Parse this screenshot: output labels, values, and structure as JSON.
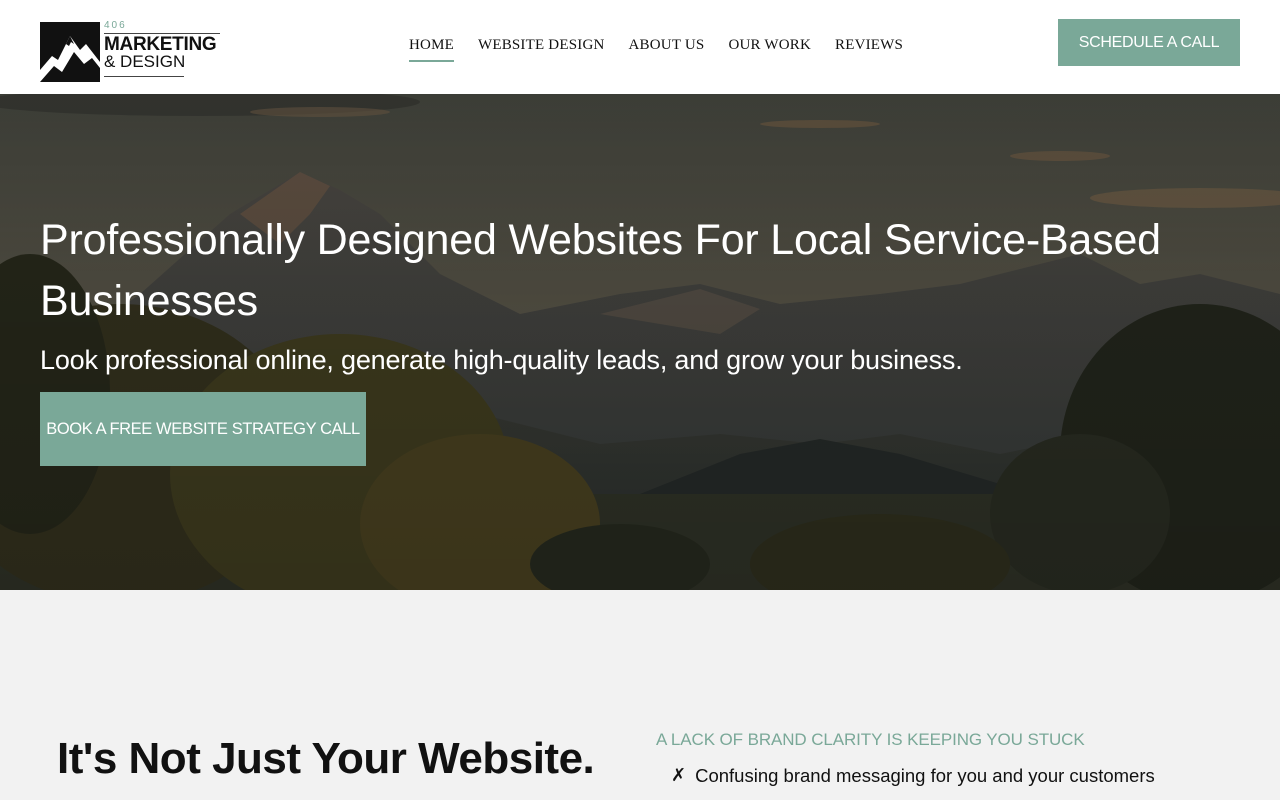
{
  "brand": {
    "number": "406",
    "line1": "MARKETING",
    "line2": "& DESIGN"
  },
  "nav": [
    {
      "label": "HOME",
      "active": true
    },
    {
      "label": "WEBSITE DESIGN",
      "active": false
    },
    {
      "label": "ABOUT US",
      "active": false
    },
    {
      "label": "OUR WORK",
      "active": false
    },
    {
      "label": "REVIEWS",
      "active": false
    }
  ],
  "header": {
    "cta_label": "SCHEDULE A CALL"
  },
  "hero": {
    "title": "Professionally Designed Websites For Local Service-Based Businesses",
    "subtitle": "Look professional online, generate high-quality leads, and grow your business.",
    "cta_label": "BOOK A FREE WEBSITE STRATEGY CALL"
  },
  "section2": {
    "heading": "It's Not Just Your Website.",
    "eyebrow": "A LACK OF BRAND CLARITY IS KEEPING YOU STUCK",
    "bullets": [
      {
        "icon": "x-mark-icon",
        "mark": "✗",
        "text": "Confusing brand messaging for you and your customers"
      }
    ]
  },
  "colors": {
    "accent": "#7aa898",
    "section_bg": "#f2f2f2"
  }
}
